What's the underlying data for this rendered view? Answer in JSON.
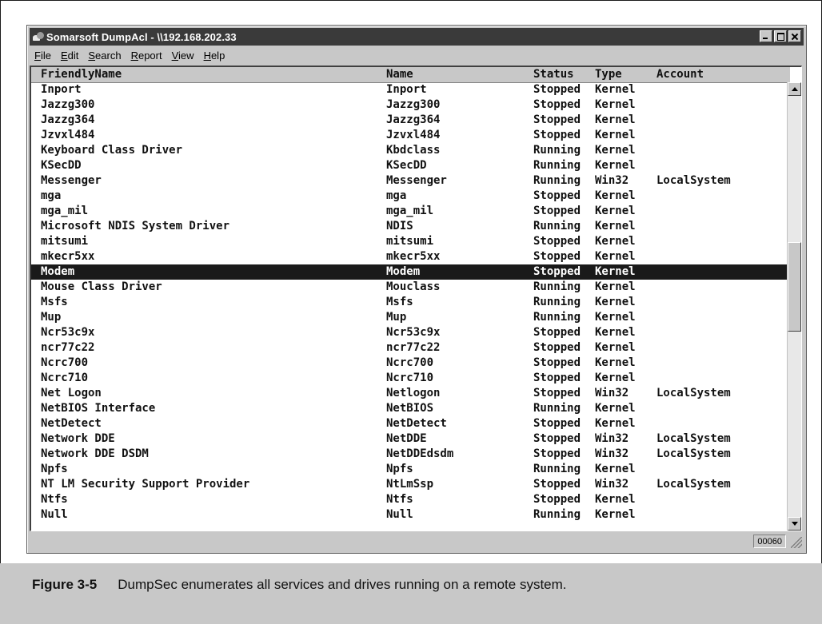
{
  "window": {
    "title": "Somarsoft DumpAcl - \\\\192.168.202.33"
  },
  "menu": [
    {
      "label": "File",
      "key": "F",
      "rest": "ile"
    },
    {
      "label": "Edit",
      "key": "E",
      "rest": "dit"
    },
    {
      "label": "Search",
      "key": "S",
      "rest": "earch"
    },
    {
      "label": "Report",
      "key": "R",
      "rest": "eport"
    },
    {
      "label": "View",
      "key": "V",
      "rest": "iew"
    },
    {
      "label": "Help",
      "key": "H",
      "rest": "elp"
    }
  ],
  "columns": [
    "FriendlyName",
    "Name",
    "Status",
    "Type",
    "Account"
  ],
  "rows": [
    [
      "Inport",
      "Inport",
      "Stopped",
      "Kernel",
      ""
    ],
    [
      "Jazzg300",
      "Jazzg300",
      "Stopped",
      "Kernel",
      ""
    ],
    [
      "Jazzg364",
      "Jazzg364",
      "Stopped",
      "Kernel",
      ""
    ],
    [
      "Jzvxl484",
      "Jzvxl484",
      "Stopped",
      "Kernel",
      ""
    ],
    [
      "Keyboard Class Driver",
      "Kbdclass",
      "Running",
      "Kernel",
      ""
    ],
    [
      "KSecDD",
      "KSecDD",
      "Running",
      "Kernel",
      ""
    ],
    [
      "Messenger",
      "Messenger",
      "Running",
      "Win32",
      "LocalSystem"
    ],
    [
      "mga",
      "mga",
      "Stopped",
      "Kernel",
      ""
    ],
    [
      "mga_mil",
      "mga_mil",
      "Stopped",
      "Kernel",
      ""
    ],
    [
      "Microsoft NDIS System Driver",
      "NDIS",
      "Running",
      "Kernel",
      ""
    ],
    [
      "mitsumi",
      "mitsumi",
      "Stopped",
      "Kernel",
      ""
    ],
    [
      "mkecr5xx",
      "mkecr5xx",
      "Stopped",
      "Kernel",
      ""
    ],
    [
      "Modem",
      "Modem",
      "Stopped",
      "Kernel",
      ""
    ],
    [
      "Mouse Class Driver",
      "Mouclass",
      "Running",
      "Kernel",
      ""
    ],
    [
      "Msfs",
      "Msfs",
      "Running",
      "Kernel",
      ""
    ],
    [
      "Mup",
      "Mup",
      "Running",
      "Kernel",
      ""
    ],
    [
      "Ncr53c9x",
      "Ncr53c9x",
      "Stopped",
      "Kernel",
      ""
    ],
    [
      "ncr77c22",
      "ncr77c22",
      "Stopped",
      "Kernel",
      ""
    ],
    [
      "Ncrc700",
      "Ncrc700",
      "Stopped",
      "Kernel",
      ""
    ],
    [
      "Ncrc710",
      "Ncrc710",
      "Stopped",
      "Kernel",
      ""
    ],
    [
      "Net Logon",
      "Netlogon",
      "Stopped",
      "Win32",
      "LocalSystem"
    ],
    [
      "NetBIOS Interface",
      "NetBIOS",
      "Running",
      "Kernel",
      ""
    ],
    [
      "NetDetect",
      "NetDetect",
      "Stopped",
      "Kernel",
      ""
    ],
    [
      "Network DDE",
      "NetDDE",
      "Stopped",
      "Win32",
      "LocalSystem"
    ],
    [
      "Network DDE DSDM",
      "NetDDEdsdm",
      "Stopped",
      "Win32",
      "LocalSystem"
    ],
    [
      "Npfs",
      "Npfs",
      "Running",
      "Kernel",
      ""
    ],
    [
      "NT LM Security Support Provider",
      "NtLmSsp",
      "Stopped",
      "Win32",
      "LocalSystem"
    ],
    [
      "Ntfs",
      "Ntfs",
      "Stopped",
      "Kernel",
      ""
    ],
    [
      "Null",
      "Null",
      "Running",
      "Kernel",
      ""
    ]
  ],
  "selected_row": "Modem",
  "status": {
    "count": "00060"
  },
  "caption": {
    "number": "Figure 3-5",
    "text": "DumpSec enumerates all services and drives running on a remote system."
  }
}
